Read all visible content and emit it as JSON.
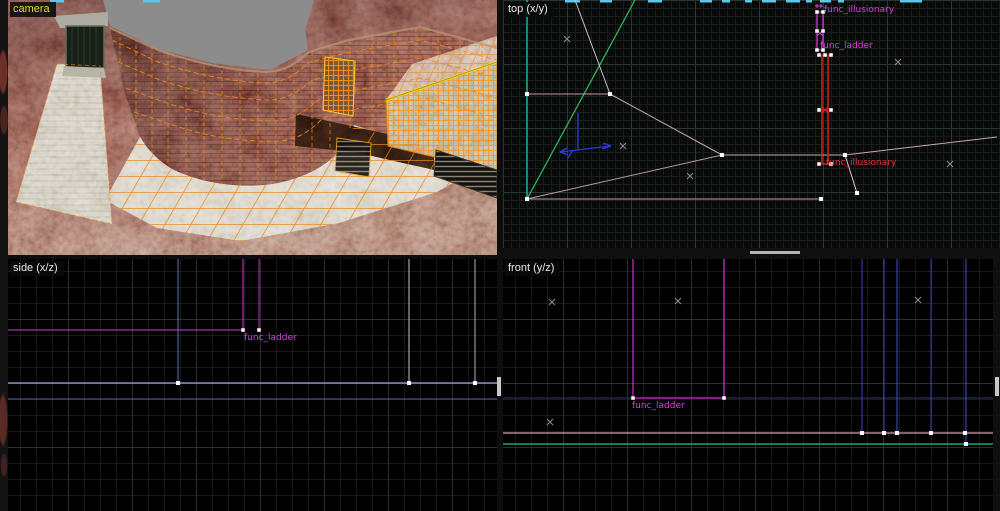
{
  "colors": {
    "camera_label": "#dcdc28",
    "viewport_label": "#e8e8e8",
    "entity_magenta": "#e03ce0",
    "entity_red": "#e83434",
    "selection_red": "#e42020",
    "wireframe_orange": "#f08818",
    "highlight_yellow": "#ece028",
    "teal_line": "#1cb8a8",
    "green_line": "#30c060",
    "pink_line": "#c894b8",
    "blue_line": "#9aa8e0",
    "indigo_line": "#3644bc",
    "spring_green_line": "#12a878",
    "cyan_dash": "#58c8e8"
  },
  "viewports": {
    "camera": {
      "label": "camera"
    },
    "top": {
      "label": "top (x/y)",
      "entity_labels": [
        {
          "name": "func_illusionary",
          "color": "magenta"
        },
        {
          "name": "func_ladder",
          "color": "magenta"
        },
        {
          "name": "func_illusionary",
          "color": "red"
        }
      ]
    },
    "side": {
      "label": "side (x/z)",
      "entity_labels": [
        {
          "name": "func_ladder",
          "color": "magenta"
        }
      ]
    },
    "front": {
      "label": "front (y/z)",
      "entity_labels": [
        {
          "name": "func_ladder",
          "color": "magenta"
        }
      ]
    }
  }
}
